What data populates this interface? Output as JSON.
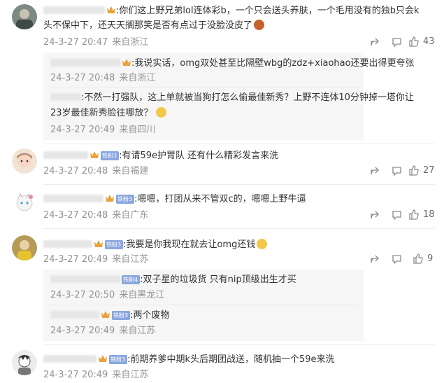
{
  "comments": [
    {
      "text_line1": ":你们这上野兄弟lol连体彩b，一个只会送头养肤，一个毛用没有的独b只会k",
      "text_line2": "头不保中下，还天天搁那笑是否有点过于没脸没皮了",
      "time": "24-3-27 20:47",
      "location": "来自浙江",
      "likes": "43",
      "replies": [
        {
          "text": ":我说实话，omg双处甚至比隔壁wbg的zdz+xiaohao还要出得更夸张",
          "time": "24-3-27 20:48",
          "location": "来自浙江"
        },
        {
          "text_line1": ":不然一打强队，这上单就被当狗打怎么偷最佳新秀？上野不连体10分钟掉一塔你让",
          "text_line2": "23岁最佳新秀脸往哪放？",
          "time": "24-3-27 20:49",
          "location": "来自四川"
        }
      ]
    },
    {
      "badge": "铁粉3",
      "text": ":有请59e护胃队 还有什么精彩发言来洗",
      "time": "24-3-27 20:48",
      "location": "来自福建",
      "likes": "27"
    },
    {
      "badge": "铁粉3",
      "text": ":嗯嗯，打团从来不管双c的，嗯嗯上野牛逼",
      "time": "24-3-27 20:48",
      "location": "来自广东",
      "likes": "18"
    },
    {
      "badge": "铁粉3",
      "text": ":我要是你我现在就去让omg还钱",
      "time": "24-3-27 20:49",
      "location": "来自江苏",
      "likes": "9",
      "replies": [
        {
          "badge": "铁粉4",
          "text": ":双子星的垃圾货 只有nip顶级出生才买",
          "time": "24-3-27 20:50",
          "location": "来自黑龙江"
        },
        {
          "badge": "铁粉3",
          "text": ":两个废物",
          "time": "24-3-27 20:49",
          "location": "来自江苏"
        }
      ]
    },
    {
      "badge": "铁粉3",
      "text": ":前期养爹中期k头后期团战送，随机抽一个59e来洗",
      "time": "24-3-27 20:49",
      "location": "来自江苏"
    }
  ],
  "icons": [
    "share-icon",
    "comment-icon",
    "like-icon",
    "crown-icon",
    "emoji-icon"
  ],
  "colors": {
    "meta": "#939393",
    "badge": "#8aa6de",
    "reply_bg": "#f6f6f6"
  }
}
